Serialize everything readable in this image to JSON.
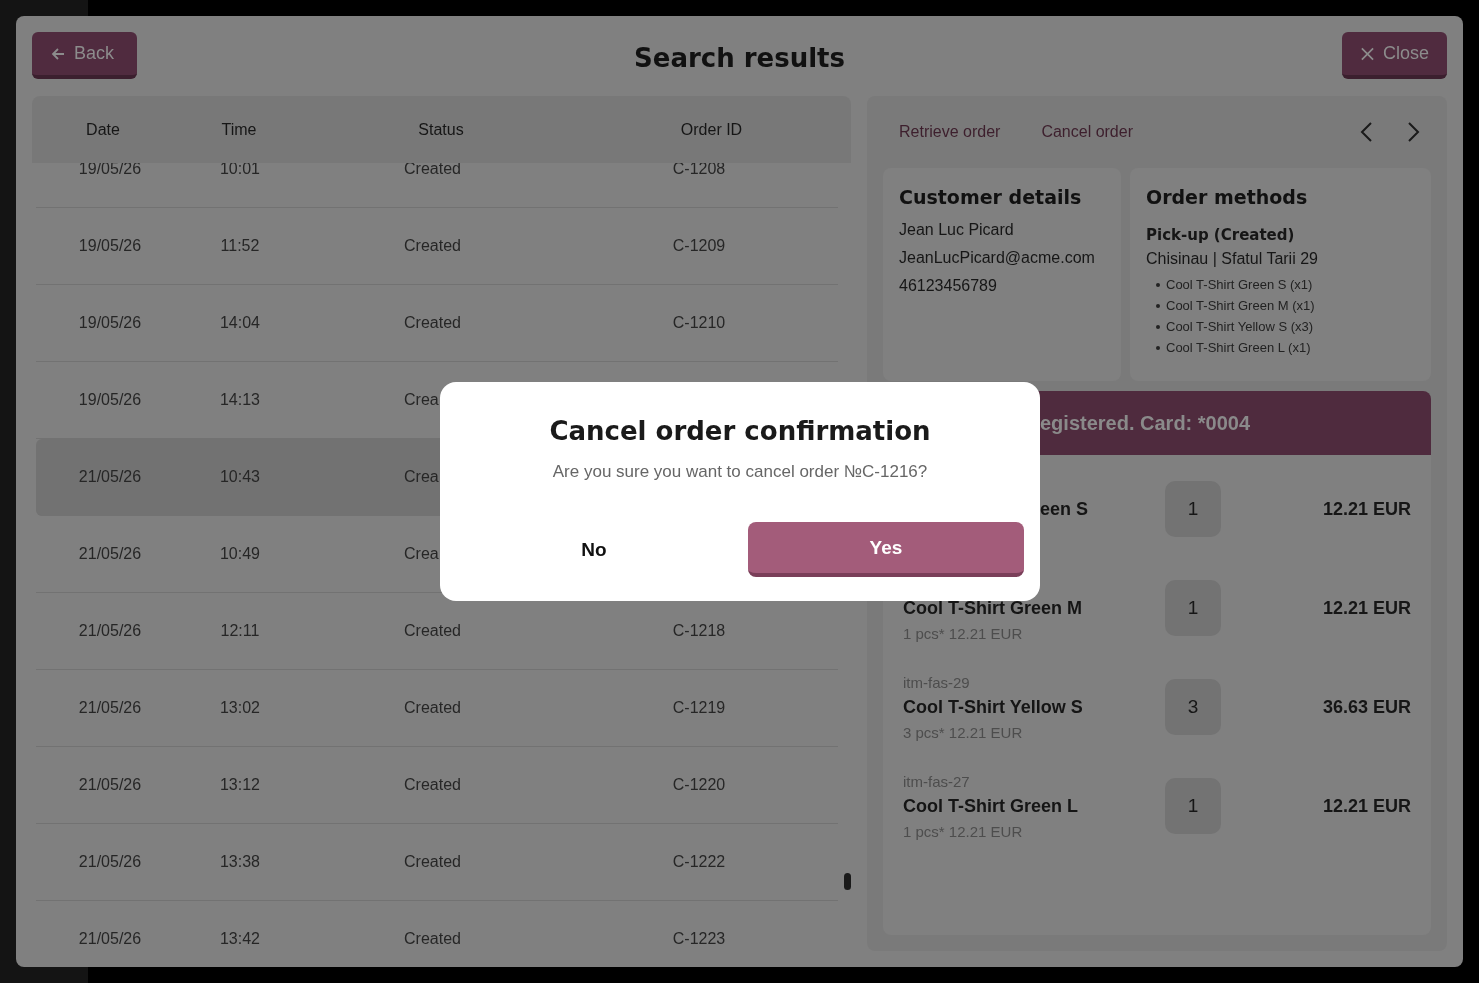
{
  "header": {
    "back": "Back",
    "title": "Search results",
    "close": "Close"
  },
  "table": {
    "columns": [
      "Date",
      "Time",
      "Status",
      "Order ID"
    ],
    "rows": [
      {
        "date": "19/05/26",
        "time": "10:01",
        "status": "Created",
        "order_id": "C-1208",
        "selected": false
      },
      {
        "date": "19/05/26",
        "time": "11:52",
        "status": "Created",
        "order_id": "C-1209",
        "selected": false
      },
      {
        "date": "19/05/26",
        "time": "14:04",
        "status": "Created",
        "order_id": "C-1210",
        "selected": false
      },
      {
        "date": "19/05/26",
        "time": "14:13",
        "status": "Crea",
        "selected": false
      },
      {
        "date": "21/05/26",
        "time": "10:43",
        "status": "Crea",
        "selected": true
      },
      {
        "date": "21/05/26",
        "time": "10:49",
        "status": "Crea",
        "selected": false
      },
      {
        "date": "21/05/26",
        "time": "12:11",
        "status": "Created",
        "order_id": "C-1218",
        "selected": false
      },
      {
        "date": "21/05/26",
        "time": "13:02",
        "status": "Created",
        "order_id": "C-1219",
        "selected": false
      },
      {
        "date": "21/05/26",
        "time": "13:12",
        "status": "Created",
        "order_id": "C-1220",
        "selected": false
      },
      {
        "date": "21/05/26",
        "time": "13:38",
        "status": "Created",
        "order_id": "C-1222",
        "selected": false
      },
      {
        "date": "21/05/26",
        "time": "13:42",
        "status": "Created",
        "order_id": "C-1223",
        "selected": false
      }
    ]
  },
  "details": {
    "actions": [
      "Retrieve order",
      "Cancel order"
    ],
    "customer": {
      "title": "Customer details",
      "lines": [
        "Jean Luc Picard",
        "JeanLucPicard@acme.com",
        "46123456789"
      ]
    },
    "order_methods": {
      "title": "Order methods",
      "method": "Pick-up (Created)",
      "address": "Chisinau | Sfatul Tarii 29",
      "items": [
        "Cool T-Shirt Green S (x1)",
        "Cool T-Shirt Green M (x1)",
        "Cool T-Shirt Yellow S (x3)",
        "Cool T-Shirt Green L (x1)"
      ]
    },
    "payment": "egistered. Card: *0004",
    "items": [
      {
        "name": "een S",
        "quantity": "1",
        "total": "12.21 EUR"
      },
      {
        "name": "Cool T-Shirt Green M",
        "detail": "1 pcs* 12.21 EUR",
        "quantity": "1",
        "total": "12.21 EUR"
      },
      {
        "sku": "itm-fas-29",
        "name": "Cool T-Shirt Yellow S",
        "detail": "3 pcs* 12.21 EUR",
        "quantity": "3",
        "total": "36.63 EUR"
      },
      {
        "sku": "itm-fas-27",
        "name": "Cool T-Shirt Green L",
        "detail": "1 pcs* 12.21 EUR",
        "quantity": "1",
        "total": "12.21 EUR"
      }
    ]
  },
  "dialog": {
    "title": "Cancel order confirmation",
    "message": "Are you sure you want to cancel order №C-1216?",
    "buttons": [
      "No",
      "Yes"
    ]
  }
}
